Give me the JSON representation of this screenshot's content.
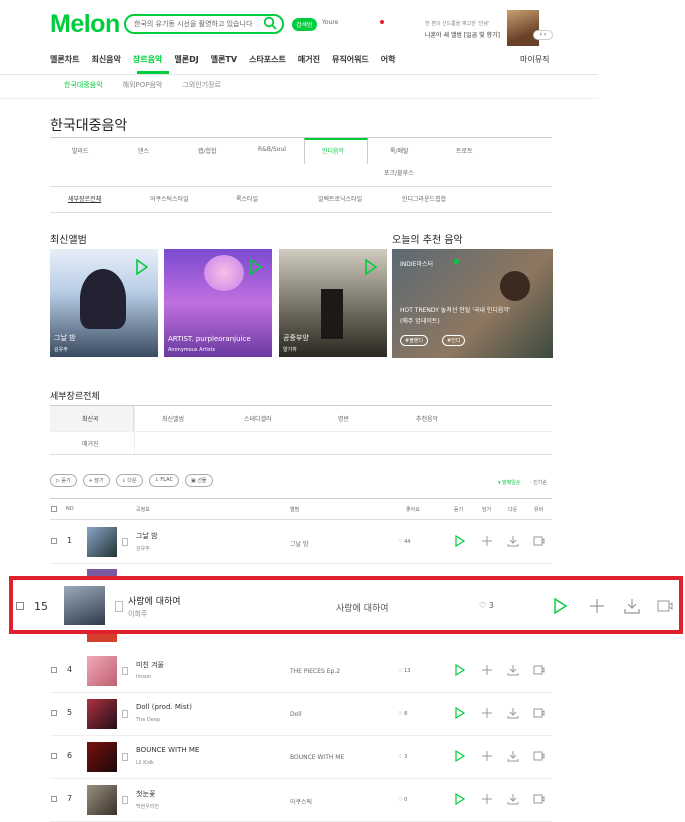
{
  "header": {
    "logo": "Melon",
    "search_placeholder": "한국의 유기동 시선을 촬영하고 있습니다",
    "badge": "검색방",
    "user_hint": "Youre",
    "promo_text": "한 편의 신드롬을 예고한 '안녕'",
    "promo_title": "나훈아 새 앨범 [일곱 빛 향기]"
  },
  "nav": {
    "items": [
      "멜론차트",
      "최신음악",
      "장르음악",
      "멜론DJ",
      "멜론TV",
      "스타포스트",
      "매거진",
      "뮤직어워드",
      "어학"
    ],
    "right": "마이뮤직",
    "active_index": 2
  },
  "subnav": {
    "items": [
      "한국대중음악",
      "해외POP음악",
      "그외인기장르"
    ],
    "active_index": 0
  },
  "page_title": "한국대중음악",
  "genre_tabs": {
    "row1": [
      "발라드",
      "댄스",
      "랩/힙합",
      "R&B/Soul",
      "인디음악",
      "록/메탈",
      "트로트"
    ],
    "row2": [
      "포크/블루스"
    ],
    "active": "인디음악"
  },
  "sub_genres": {
    "items": [
      "세부장르전체",
      "어쿠스틱스타일",
      "록스타일",
      "일렉트로닉스타일",
      "인디그라운드힙합"
    ],
    "active_index": 0
  },
  "latest_albums": {
    "title": "최신앨범",
    "cards": [
      {
        "title": "그날 밤",
        "artist": "김유주",
        "colors": [
          "#8aa5c8",
          "#d9e6f2"
        ]
      },
      {
        "title": "ARTIST. purpleoranjuice",
        "artist": "Anonymous Artists",
        "colors": [
          "#a85ad8",
          "#e6a0e8"
        ]
      },
      {
        "title": "공중부양",
        "artist": "알기하",
        "colors": [
          "#4a4a42",
          "#c8c0a8"
        ]
      }
    ]
  },
  "recommend": {
    "title": "오늘의 추천 음악",
    "badge": "INDIE마스터",
    "headline": "HOT TRENDY 놓쳐선 안될 '국내 인디음악'",
    "sub": "(매주 업데이트)",
    "tags": [
      "#블랜디",
      "#인디"
    ]
  },
  "detail": {
    "title": "세부장르전체",
    "tabs_row1": [
      "최신곡",
      "최신앨범",
      "스테디셀러",
      "명반",
      "추천음악"
    ],
    "tabs_row2": [
      "매거진"
    ]
  },
  "toolbar": {
    "buttons": [
      "듣기",
      "담기",
      "다운",
      "FLAC",
      "선물"
    ],
    "sort_primary": "발매일순",
    "sort_secondary": "인기순"
  },
  "table": {
    "headers": [
      "NO",
      "곡정보",
      "앨범",
      "좋아요",
      "듣기",
      "담기",
      "다운",
      "뮤비"
    ],
    "rows": [
      {
        "rank": "1",
        "song": "그날 밤",
        "artist": "김유주",
        "album": "그날 밤",
        "likes": "44",
        "thumb": [
          "#8aa5c8",
          "#233"
        ]
      },
      {
        "rank": "4",
        "song": "미친 겨울",
        "artist": "Imsoo",
        "album": "THE PIECES Ep.2",
        "likes": "13",
        "thumb": [
          "#f0a8b8",
          "#c06070"
        ]
      },
      {
        "rank": "5",
        "song": "Doll (prod. Mist)",
        "artist": "The Deep",
        "album": "Doll",
        "likes": "8",
        "thumb": [
          "#b03040",
          "#201018"
        ]
      },
      {
        "rank": "6",
        "song": "BOUNCE WITH ME",
        "artist": "Lil Kidk",
        "album": "BOUNCE WITH ME",
        "likes": "3",
        "thumb": [
          "#7a1010",
          "#1a0808"
        ]
      },
      {
        "rank": "7",
        "song": "첫눈꽃",
        "artist": "백현우리진",
        "album": "아쿠스틱",
        "likes": "0",
        "thumb": [
          "#9a9080",
          "#3a3028"
        ]
      }
    ]
  },
  "highlight_row": {
    "rank": "15",
    "song": "사랑에 대하여",
    "artist": "이희주",
    "album": "사랑에 대하여",
    "likes": "3",
    "highlight_color": "#e0202d"
  },
  "colors": {
    "accent": "#00cd3c"
  }
}
